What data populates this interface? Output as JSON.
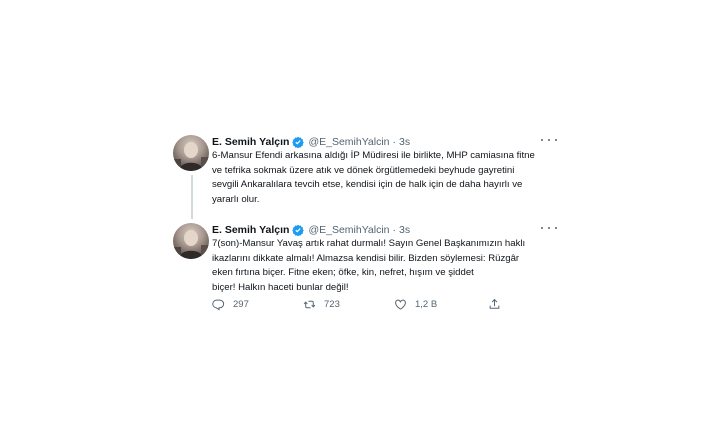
{
  "tweets": [
    {
      "author_name": "E. Semih Yalçın",
      "handle": "@E_SemihYalcin",
      "separator": "·",
      "time": "3s",
      "lines": [
        "6-Mansur Efendi arkasına aldığı İP Müdiresi ile birlikte, MHP camiasına fitne",
        "ve tefrika sokmak üzere atık ve dönek örgütlemedeki beyhude gayretini",
        "sevgili Ankaralılara tevcih etse, kendisi için de halk için de daha hayırlı ve",
        "yararlı olur."
      ]
    },
    {
      "author_name": "E. Semih Yalçın",
      "handle": "@E_SemihYalcin",
      "separator": "·",
      "time": "3s",
      "lines": [
        "7(son)-Mansur Yavaş artık rahat durmalı! Sayın Genel Başkanımızın haklı",
        "ikazlarını dikkate almalı! Almazsa kendisi bilir. Bizden söylemesi: Rüzgâr",
        "eken fırtına biçer. Fitne eken; öfke, kin, nefret, hışım ve şiddet",
        "biçer! Halkın haceti bunlar değil!"
      ]
    }
  ],
  "actions": {
    "reply_icon": "reply-icon",
    "reply_count": "297",
    "retweet_icon": "retweet-icon",
    "retweet_count": "723",
    "like_icon": "heart-icon",
    "like_count": "1,2 B",
    "share_icon": "share-icon"
  },
  "colors": {
    "verified_blue": "#1d9bf0",
    "secondary_text": "#536471",
    "primary_text": "#0f1419",
    "thread_line": "#cfd9de"
  }
}
